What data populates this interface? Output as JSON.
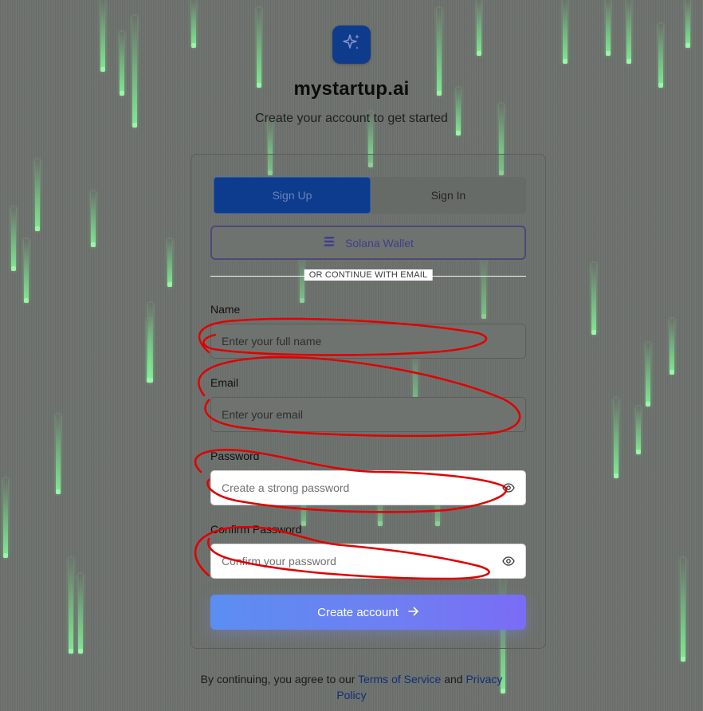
{
  "brand": {
    "name": "mystartup.ai",
    "tagline": "Create your account to get started",
    "logo_icon": "sparkles-icon"
  },
  "auth": {
    "tabs": [
      {
        "label": "Sign Up",
        "active": true
      },
      {
        "label": "Sign In",
        "active": false
      }
    ],
    "wallet_button": {
      "label": "Solana Wallet",
      "icon": "solana-icon"
    },
    "divider_text": "OR CONTINUE WITH EMAIL",
    "fields": {
      "name": {
        "label": "Name",
        "placeholder": "Enter your full name"
      },
      "email": {
        "label": "Email",
        "placeholder": "Enter your email"
      },
      "password": {
        "label": "Password",
        "placeholder": "Create a strong password",
        "icon": "eye-icon"
      },
      "confirm_password": {
        "label": "Confirm Password",
        "placeholder": "Confirm your password",
        "icon": "eye-icon"
      }
    },
    "submit": {
      "label": "Create account",
      "icon": "arrow-right-icon"
    }
  },
  "footer": {
    "prefix": "By continuing, you agree to our",
    "terms_link": "Terms of Service",
    "conjunction": "and",
    "privacy_link_part1": "Privacy",
    "privacy_link_part2": "Policy"
  },
  "colors": {
    "accent": "#0d3b8e",
    "button_gradient_start": "#5b8ef2",
    "button_gradient_end": "#7a6cf5",
    "annotation_red": "#e00000",
    "rain_green": "#8df09f"
  }
}
